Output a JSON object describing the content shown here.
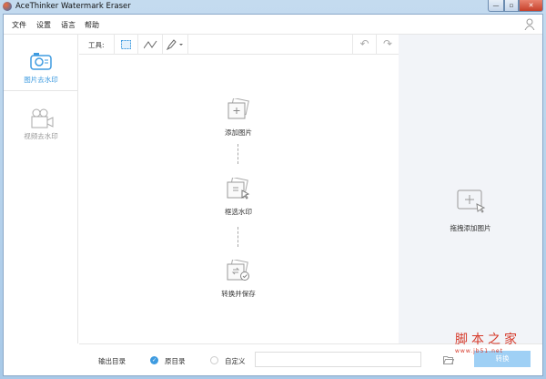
{
  "window": {
    "title": "AceThinker Watermark Eraser",
    "minimize": "—",
    "maximize": "▫",
    "close": "✕"
  },
  "menu": [
    "文件",
    "设置",
    "语言",
    "帮助"
  ],
  "sidebar": {
    "items": [
      {
        "label": "图片去水印",
        "active": true
      },
      {
        "label": "视频去水印",
        "active": false
      }
    ]
  },
  "toolbar": {
    "label": "工具:"
  },
  "steps": [
    {
      "label": "添加图片"
    },
    {
      "label": "框选水印"
    },
    {
      "label": "转换并保存"
    }
  ],
  "right_panel": {
    "label": "拖拽添加图片"
  },
  "bottom": {
    "output_label": "输出目录",
    "option_original": "原目录",
    "option_custom": "自定义",
    "path_value": "",
    "convert_label": "转换"
  },
  "watermark": {
    "text": "脚本之家",
    "url": "www.jb51.net"
  },
  "colors": {
    "accent": "#3e9be0",
    "button": "#9fd0f5"
  }
}
